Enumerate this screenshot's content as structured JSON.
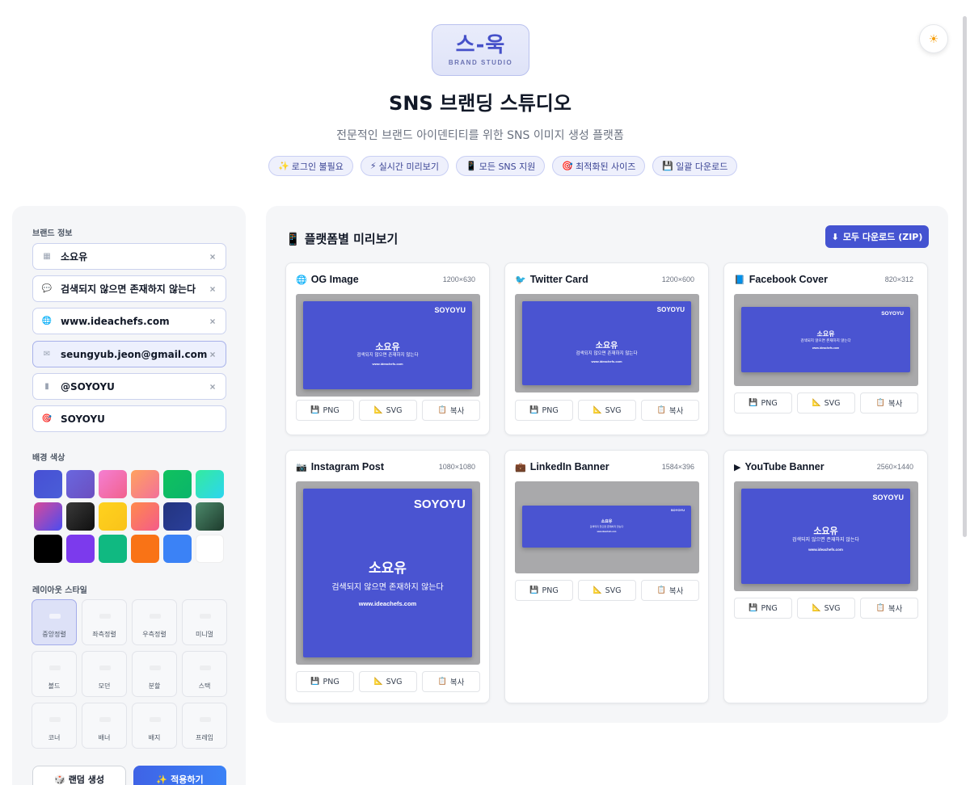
{
  "header": {
    "logo_mark": "스-욱",
    "logo_sub": "BRAND STUDIO",
    "theme_icon": "sun-icon",
    "title": "SNS 브랜딩 스튜디오",
    "subtitle": "전문적인 브랜드 아이덴티티를 위한 SNS 이미지 생성 플랫폼",
    "features": [
      {
        "icon": "✨",
        "label": "로그인 불필요"
      },
      {
        "icon": "⚡",
        "label": "실시간 미리보기"
      },
      {
        "icon": "📱",
        "label": "모든 SNS 지원"
      },
      {
        "icon": "🎯",
        "label": "최적화된 사이즈"
      },
      {
        "icon": "💾",
        "label": "일괄 다운로드"
      }
    ]
  },
  "sidebar": {
    "brand_label": "브랜드 정보",
    "fields": [
      {
        "icon": "▦",
        "value": "소요유"
      },
      {
        "icon": "💬",
        "value": "검색되지 않으면 존재하지 않는다"
      },
      {
        "icon": "🌐",
        "value": "www.ideachefs.com"
      },
      {
        "icon": "✉",
        "value": "seungyub.jeon@gmail.com"
      },
      {
        "icon": "▮",
        "value": "@SOYOYU"
      },
      {
        "icon": "🎯",
        "value": "SOYOYU"
      }
    ],
    "clear_glyph": "×",
    "color_label": "배경 색상",
    "swatches": [
      "linear-gradient(135deg,#4750d4,#4a5ed8)",
      "linear-gradient(135deg,#6a67df,#6b4fc0)",
      "linear-gradient(135deg,#f47fd3,#f2618d)",
      "linear-gradient(135deg,#ffa25e,#f3709a)",
      "linear-gradient(135deg,#10c25e,#0bb56b)",
      "linear-gradient(135deg,#34eb9e,#2cd5f0)",
      "linear-gradient(135deg,#d84a9a,#4b4cf0)",
      "linear-gradient(135deg,#3a3a3a,#0f0f0f)",
      "linear-gradient(135deg,#ffd21e,#f9c31a)",
      "linear-gradient(135deg,#ff8a4c,#f45b8a)",
      "linear-gradient(135deg,#23347f,#2a3f9a)",
      "linear-gradient(135deg,#4d8a6c,#1d3b2c)",
      "#000000",
      "#7c3aed",
      "#10b981",
      "#f97316",
      "#3b82f6",
      "#ffffff"
    ],
    "layout_label": "레이아웃 스타일",
    "layouts": [
      "중앙정렬",
      "좌측정렬",
      "우측정렬",
      "미니멀",
      "볼드",
      "모던",
      "분할",
      "스택",
      "코너",
      "배너",
      "배지",
      "프레임"
    ],
    "random_icon": "🎲",
    "random_label": "랜덤 생성",
    "apply_icon": "✨",
    "apply_label": "적용하기"
  },
  "main": {
    "title_icon": "📱",
    "title": "플랫폼별 미리보기",
    "download_all_icon": "⬇",
    "download_all": "모두 다운로드 (ZIP)",
    "actions": [
      {
        "icon": "💾",
        "label": "PNG"
      },
      {
        "icon": "📐",
        "label": "SVG"
      },
      {
        "icon": "📋",
        "label": "복사"
      }
    ],
    "preview_text": {
      "brand": "SOYOYU",
      "name": "소요유",
      "tagline": "검색되지 않으면 존재하지 않는다",
      "url": "www.ideachefs.com"
    },
    "cards": [
      {
        "icon": "🌐",
        "name": "OG Image",
        "size": "1200×630"
      },
      {
        "icon": "🐦",
        "name": "Twitter Card",
        "size": "1200×600"
      },
      {
        "icon": "📘",
        "name": "Facebook Cover",
        "size": "820×312"
      },
      {
        "icon": "📷",
        "name": "Instagram Post",
        "size": "1080×1080"
      },
      {
        "icon": "💼",
        "name": "LinkedIn Banner",
        "size": "1584×396"
      },
      {
        "icon": "▶",
        "name": "YouTube Banner",
        "size": "2560×1440"
      }
    ]
  },
  "colors": {
    "accent": "#4453d1",
    "preview_bg": "#4a54d1",
    "apply_button": "#3f63e6"
  }
}
